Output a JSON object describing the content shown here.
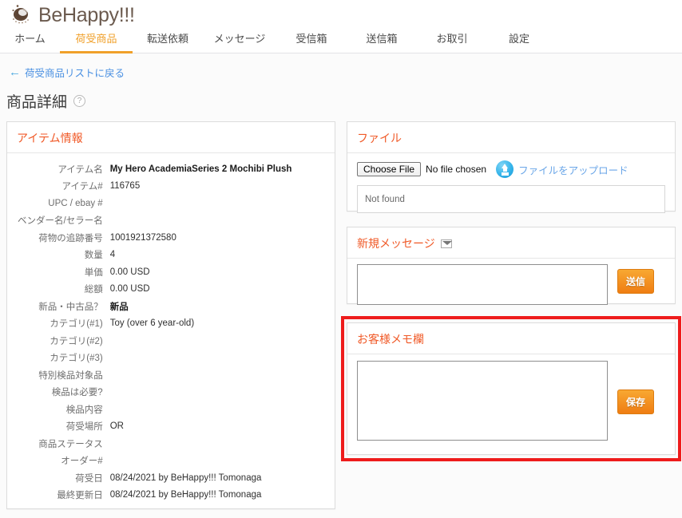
{
  "brand": {
    "name": "BeHappy!!!",
    "logo_icon": "coffee-bean-logo"
  },
  "nav": {
    "items": [
      {
        "label": "ホーム",
        "active": false
      },
      {
        "label": "荷受商品",
        "active": true
      },
      {
        "label": "転送依頼",
        "active": false
      },
      {
        "label": "メッセージ",
        "active": false
      },
      {
        "label": "受信箱",
        "active": false
      },
      {
        "label": "送信箱",
        "active": false
      },
      {
        "label": "お取引",
        "active": false
      },
      {
        "label": "設定",
        "active": false
      }
    ],
    "active_color": "#f0a02a"
  },
  "back_link": {
    "label": "荷受商品リストに戻る",
    "icon": "arrow-left-icon"
  },
  "page_title": {
    "label": "商品詳細",
    "help_icon": "help-circle-icon"
  },
  "item_panel": {
    "heading": "アイテム情報",
    "rows": [
      {
        "label": "アイテム名",
        "value": "My Hero AcademiaSeries 2 Mochibi Plush",
        "bold": true
      },
      {
        "label": "アイテム#",
        "value": "116765",
        "bold": false
      },
      {
        "label": "UPC / ebay #",
        "value": "",
        "bold": false
      },
      {
        "label": "ベンダー名/セラー名",
        "value": "",
        "bold": false
      },
      {
        "label": "荷物の追跡番号",
        "value": "1001921372580",
        "bold": false
      },
      {
        "label": "数量",
        "value": "4",
        "bold": false
      },
      {
        "label": "単価",
        "value": "0.00 USD",
        "bold": false
      },
      {
        "label": "総額",
        "value": "0.00 USD",
        "bold": false
      },
      {
        "label": "新品・中古品？",
        "value": "新品",
        "bold": true
      },
      {
        "label": "カテゴリ(#1)",
        "value": "Toy (over 6 year-old)",
        "bold": false
      },
      {
        "label": "カテゴリ(#2)",
        "value": "",
        "bold": false
      },
      {
        "label": "カテゴリ(#3)",
        "value": "",
        "bold": false
      },
      {
        "label": "特別検品対象品",
        "value": "",
        "bold": false
      },
      {
        "label": "検品は必要?",
        "value": "",
        "bold": false
      },
      {
        "label": "検品内容",
        "value": "",
        "bold": false
      },
      {
        "label": "荷受場所",
        "value": "OR",
        "bold": false
      },
      {
        "label": "商品ステータス",
        "value": "",
        "bold": false
      },
      {
        "label": "オーダー#",
        "value": "",
        "bold": false
      },
      {
        "label": "荷受日",
        "value": "08/24/2021 by BeHappy!!! Tomonaga",
        "bold": false
      },
      {
        "label": "最終更新日",
        "value": "08/24/2021 by BeHappy!!! Tomonaga",
        "bold": false
      }
    ]
  },
  "file_panel": {
    "heading": "ファイル",
    "choose_button": "Choose File",
    "no_file_text": "No file chosen",
    "upload_icon": "upload-circle-icon",
    "upload_link": "ファイルをアップロード",
    "list_empty_text": "Not found"
  },
  "message_panel": {
    "heading": "新規メッセージ",
    "mail_icon": "envelope-icon",
    "textarea_value": "",
    "send_button": "送信"
  },
  "memo_panel": {
    "heading": "お客様メモ欄",
    "textarea_value": "",
    "save_button": "保存",
    "highlight_color": "#ee1c1c"
  }
}
